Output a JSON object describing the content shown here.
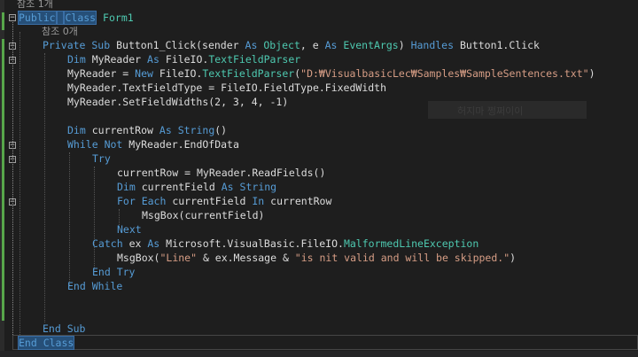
{
  "editor": {
    "ref_count_class": "참조 1개",
    "ref_count_sub": "참조 0개",
    "ghost_text": "허지마 쩡쩌이이",
    "lines": {
      "l1_kw1": "Public",
      "l1_kw2": "Class",
      "l1_name": "Form1",
      "l3_kw1": "Private Sub",
      "l3_text1": "Button1_Click(sender",
      "l3_kw2": "As",
      "l3_type1": "Object",
      "l3_text2": ", e",
      "l3_kw3": "As",
      "l3_type2": "EventArgs",
      "l3_kw4": "Handles",
      "l3_text3": "Button1.Click",
      "l4_kw1": "Dim",
      "l4_text1": "MyReader",
      "l4_kw2": "As",
      "l4_text2": "FileIO.",
      "l4_type": "TextFieldParser",
      "l5_text1": "MyReader = ",
      "l5_kw": "New",
      "l5_text2": "FileIO.",
      "l5_type": "TextFieldParser",
      "l5_text3": "(",
      "l5_str": "\"D:₩VisualbasicLec₩Samples₩SampleSentences.txt\"",
      "l5_text4": ")",
      "l6_text": "MyReader.TextFieldType = FileIO.FieldType.FixedWidth",
      "l7_text": "MyReader.SetFieldWidths(2, 3, 4, -1)",
      "l9_kw1": "Dim",
      "l9_text1": "currentRow",
      "l9_kw2": "As",
      "l9_kw3": "String",
      "l9_text2": "()",
      "l10_kw1": "While",
      "l10_kw2": "Not",
      "l10_text": "MyReader.EndOfData",
      "l11_kw": "Try",
      "l12_text": "currentRow = MyReader.ReadFields()",
      "l13_kw1": "Dim",
      "l13_text": "currentField",
      "l13_kw2": "As",
      "l13_kw3": "String",
      "l14_kw1": "For Each",
      "l14_text1": "currentField",
      "l14_kw2": "In",
      "l14_text2": "currentRow",
      "l15_text": "MsgBox(currentField)",
      "l16_kw": "Next",
      "l17_kw1": "Catch",
      "l17_text1": "ex",
      "l17_kw2": "As",
      "l17_text2": "Microsoft.VisualBasic.FileIO.",
      "l17_type": "MalformedLineException",
      "l18_text1": "MsgBox(",
      "l18_str1": "\"Line\"",
      "l18_text2": " & ex.Message & ",
      "l18_str2": "\"is nit valid and will be skipped.\"",
      "l18_text3": ")",
      "l19_kw": "End Try",
      "l20_kw": "End While",
      "l23_kw": "End Sub",
      "l24_kw": "End Class"
    },
    "colors": {
      "background": "#1e1e1e",
      "keyword": "#569cd6",
      "type": "#4ec9b0",
      "string": "#d69d85",
      "identifier": "#dcdcdc",
      "reference_lens": "#9a9a9a",
      "selection": "#264f78",
      "change_marker": "#57a64a"
    }
  }
}
